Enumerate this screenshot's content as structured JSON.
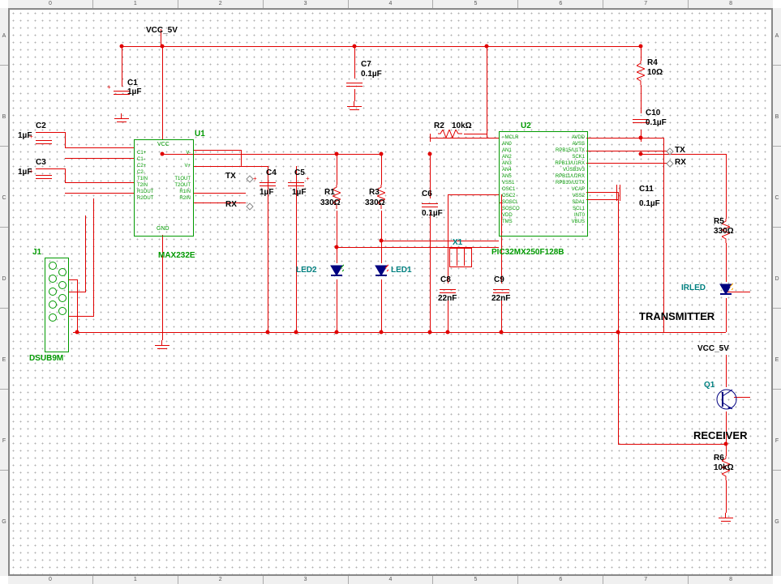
{
  "ruler_top": [
    "0",
    "1",
    "2",
    "3",
    "4",
    "5",
    "6",
    "7",
    "8"
  ],
  "ruler_side": [
    "A",
    "B",
    "C",
    "D",
    "E",
    "F",
    "G"
  ],
  "vcc1": "VCC_5V",
  "vcc2": "VCC_5V",
  "transmitter": "TRANSMITTER",
  "receiver": "RECEIVER",
  "tx": "TX",
  "rx": "RX",
  "tx2": "TX",
  "rx2": "RX",
  "parts": {
    "C1": {
      "ref": "C1",
      "val": "1µF"
    },
    "C2": {
      "ref": "C2",
      "val": "1µF"
    },
    "C3": {
      "ref": "C3",
      "val": "1µF"
    },
    "C4": {
      "ref": "C4",
      "val": "1µF"
    },
    "C5": {
      "ref": "C5",
      "val": "1µF"
    },
    "C6": {
      "ref": "C6",
      "val": "0.1µF"
    },
    "C7": {
      "ref": "C7",
      "val": "0.1µF"
    },
    "C8": {
      "ref": "C8",
      "val": "22nF"
    },
    "C9": {
      "ref": "C9",
      "val": "22nF"
    },
    "C10": {
      "ref": "C10",
      "val": "0.1µF"
    },
    "C11": {
      "ref": "C11",
      "val": "0.1µF"
    },
    "R1": {
      "ref": "R1",
      "val": "330Ω"
    },
    "R2": {
      "ref": "R2",
      "val": "10kΩ"
    },
    "R3": {
      "ref": "R3",
      "val": "330Ω"
    },
    "R4": {
      "ref": "R4",
      "val": "10Ω"
    },
    "R5": {
      "ref": "R5",
      "val": "330Ω"
    },
    "R6": {
      "ref": "R6",
      "val": "10kΩ"
    },
    "X1": {
      "ref": "X1"
    },
    "J1": {
      "ref": "J1",
      "val": "DSUB9M"
    },
    "U1": {
      "ref": "U1",
      "val": "MAX232E"
    },
    "U2": {
      "ref": "U2",
      "val": "PIC32MX250F128B"
    },
    "LED1": {
      "ref": "LED1"
    },
    "LED2": {
      "ref": "LED2"
    },
    "IRLED": {
      "ref": "IRLED"
    },
    "Q1": {
      "ref": "Q1"
    }
  },
  "u1_pins_left": [
    "C1+",
    "C1-",
    "C2+",
    "C2-",
    "",
    "T1IN",
    "T2IN",
    "",
    "R1OUT",
    "R2OUT"
  ],
  "u1_pins_right": [
    "V-",
    "",
    "V+",
    "",
    "",
    "T1OUT",
    "T2OUT",
    "",
    "R1IN",
    "R2IN"
  ],
  "u1_top": "VCC",
  "u1_bot": "GND",
  "u2_pins_left": [
    "~MCLR",
    "AN0",
    "AN1",
    "AN2",
    "AN3",
    "AN4",
    "AN5",
    "VSS1",
    "OSC1",
    "OSC2",
    "SOSCI",
    "SOSCO",
    "VDD",
    "TMS"
  ],
  "u2_pins_right": [
    "AVDD",
    "AVSS",
    "RPB15/U1TX",
    "SCK1",
    "RPB13/U1RX",
    "VUSB3V3",
    "RPB11/U2RX",
    "RPB10/U2TX",
    "VCAP",
    "VSS2",
    "SDA1",
    "SCL1",
    "INT0",
    "VBUS"
  ]
}
